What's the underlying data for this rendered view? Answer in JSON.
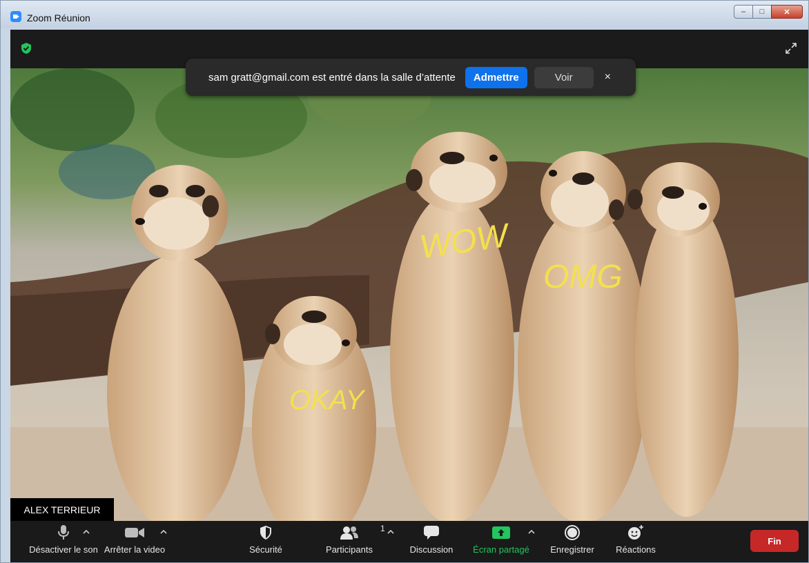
{
  "window": {
    "title": "Zoom Réunion",
    "minimize": "–",
    "maximize": "□",
    "close": "✕"
  },
  "notification": {
    "text": "sam gratt@gmail.com est entré dans la salle d’attente",
    "admit_label": "Admettre",
    "view_label": "Voir",
    "close_label": "×"
  },
  "video": {
    "participant_name": "ALEX TERRIEUR",
    "annotations": [
      "WOW",
      "OMG",
      "OKAY"
    ]
  },
  "toolbar": {
    "mute_label": "Désactiver le son",
    "video_label": "Arrêter la video",
    "security_label": "Sécurité",
    "participants_label": "Participants",
    "participants_count": "1",
    "chat_label": "Discussion",
    "share_label": "Écran partagé",
    "record_label": "Enregistrer",
    "reactions_label": "Réactions",
    "end_label": "Fin"
  },
  "colors": {
    "accent": "#0e72ed",
    "share": "#22c55e",
    "end": "#c62828",
    "annotation": "#f4e04d"
  }
}
